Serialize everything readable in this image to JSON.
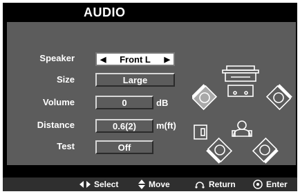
{
  "title": "AUDIO",
  "rows": [
    {
      "label": "Speaker",
      "value": "Front L"
    },
    {
      "label": "Size",
      "value": "Large"
    },
    {
      "label": "Volume",
      "value": "0",
      "unit": "dB"
    },
    {
      "label": "Distance",
      "value": "0.6(2)",
      "unit": "m(ft)"
    },
    {
      "label": "Test",
      "value": "Off"
    }
  ],
  "nav": {
    "select": "Select",
    "move": "Move",
    "return": "Return",
    "enter": "Enter"
  }
}
